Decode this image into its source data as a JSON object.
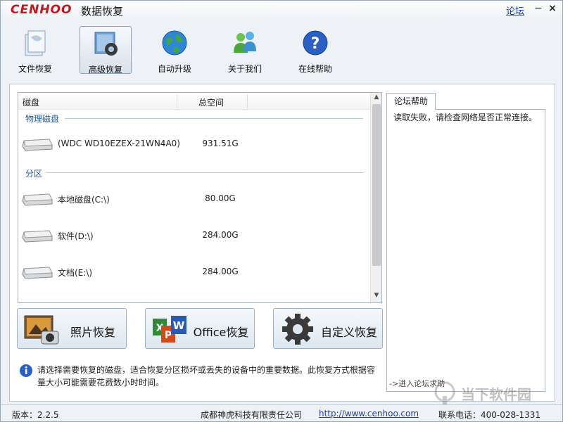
{
  "app": {
    "logo_text": "CENHOO",
    "title": "数据恢复",
    "forum_link": "论坛",
    "minimize": "−",
    "close": "×"
  },
  "toolbar": [
    {
      "label": "文件恢复",
      "icon": "file-icon"
    },
    {
      "label": "高级恢复",
      "icon": "gear-icon"
    },
    {
      "label": "自动升级",
      "icon": "globe-icon"
    },
    {
      "label": "关于我们",
      "icon": "people-icon"
    },
    {
      "label": "在线帮助",
      "icon": "help-icon"
    }
  ],
  "disklist": {
    "col_disk": "磁盘",
    "col_space": "总空间",
    "group_physical": "物理磁盘",
    "group_partition": "分区",
    "physical": [
      {
        "name": "(WDC WD10EZEX-21WN4A0)",
        "size": "931.51G"
      }
    ],
    "partitions": [
      {
        "name": "本地磁盘(C:\\)",
        "size": "80.00G"
      },
      {
        "name": "软件(D:\\)",
        "size": "284.00G"
      },
      {
        "name": "文档(E:\\)",
        "size": "284.00G"
      }
    ]
  },
  "buttons": {
    "photo": "照片恢复",
    "office": "Office恢复",
    "custom": "自定义恢复"
  },
  "info_text": "请选择需要恢复的磁盘，适合恢复分区损坏或丢失的设备中的重要数据。此恢复方式根据容量大小可能需要花费数小时时间。",
  "sidepanel": {
    "tab": "论坛帮助",
    "message": "读取失败，请检查网络是否正常连接。",
    "forum_help": "->进入论坛求助"
  },
  "status": {
    "version": "版本：2.2.5",
    "company": "成都神虎科技有限责任公司",
    "url": "http://www.cenhoo.com",
    "phone": "联系电话：400-028-1331"
  },
  "watermark": "当下软件园",
  "colors": {
    "logo_red": "#c4161c",
    "link_blue": "#1a3fb0",
    "group_blue": "#1f5ea8"
  }
}
